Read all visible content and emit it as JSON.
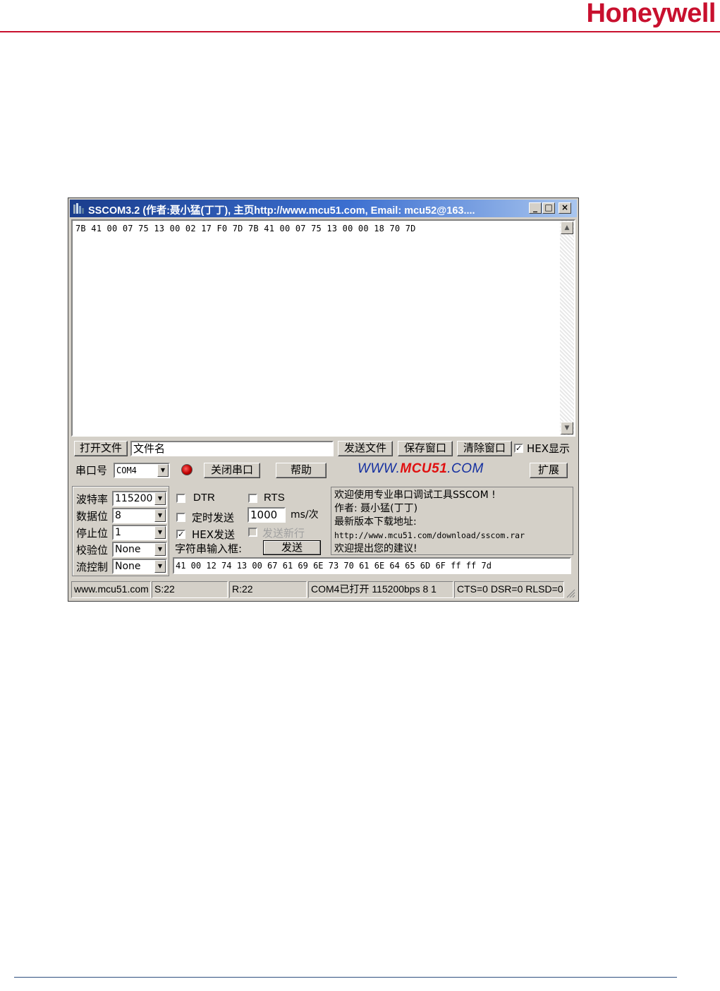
{
  "page": {
    "brand_logo": "Honeywell"
  },
  "window": {
    "title": "SSCOM3.2 (作者:聂小猛(丁丁), 主页http://www.mcu51.com,  Email: mcu52@163....",
    "icons": {
      "app": "app-icon",
      "minimize": "minimize-icon",
      "maximize": "maximize-icon",
      "close": "close-icon"
    }
  },
  "receive_area": {
    "text": "7B 41 00 07 75 13 00 02 17 F0 7D 7B 41 00 07 75 13 00 00 18 70 7D"
  },
  "file_row": {
    "open_file": "打开文件",
    "filename_value": "文件名",
    "send_file": "发送文件",
    "save_window": "保存窗口",
    "clear_window": "清除窗口",
    "hex_display": "HEX显示",
    "hex_display_checked": true
  },
  "port_row": {
    "port_label": "串口号",
    "port_value": "COM4",
    "close_port": "关闭串口",
    "help": "帮助",
    "banner_prefix": "WWW.",
    "banner_brand": "MCU51",
    "banner_suffix": ".COM",
    "expand": "扩展"
  },
  "settings": {
    "baud_label": "波特率",
    "baud_value": "115200",
    "data_bits_label": "数据位",
    "data_bits_value": "8",
    "stop_bits_label": "停止位",
    "stop_bits_value": "1",
    "parity_label": "校验位",
    "parity_value": "None",
    "flow_label": "流控制",
    "flow_value": "None"
  },
  "options": {
    "dtr": "DTR",
    "dtr_checked": false,
    "rts": "RTS",
    "rts_checked": false,
    "timed_send": "定时发送",
    "timed_send_checked": false,
    "interval_value": "1000",
    "interval_unit": "ms/次",
    "hex_send": "HEX发送",
    "hex_send_checked": true,
    "send_newline": "发送新行",
    "send_newline_checked": false,
    "input_label": "字符串输入框:",
    "send": "发送"
  },
  "info_box": {
    "lines": [
      "欢迎使用专业串口调试工具SSCOM !",
      "作者: 聂小猛(丁丁)",
      "最新版本下载地址:",
      "http://www.mcu51.com/download/sscom.rar",
      "欢迎提出您的建议!"
    ]
  },
  "send_input": {
    "value": "41 00 12 74 13 00 67 61 69 6E 73 70 61 6E 64 65 6D 6F ff ff 7d"
  },
  "status_bar": {
    "site": "www.mcu51.com",
    "sent": "S:22",
    "received": "R:22",
    "port_status": "COM4已打开  115200bps  8 1",
    "signals": "CTS=0 DSR=0 RLSD=0"
  }
}
